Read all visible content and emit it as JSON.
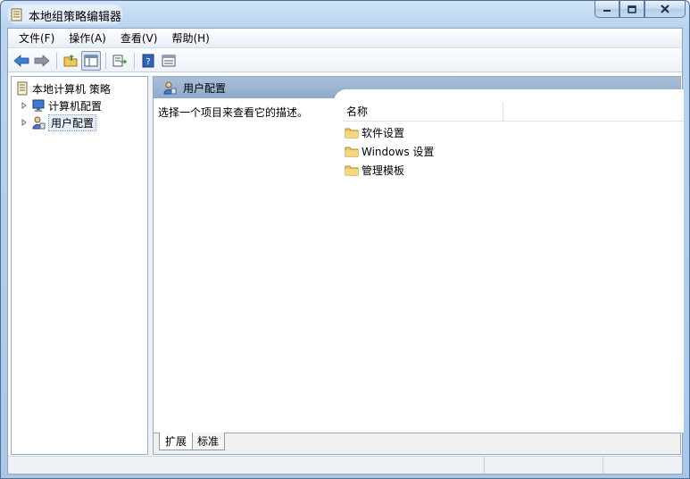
{
  "window": {
    "title": "本地组策略编辑器"
  },
  "menu": {
    "items": [
      {
        "label": "文件(F)"
      },
      {
        "label": "操作(A)"
      },
      {
        "label": "查看(V)"
      },
      {
        "label": "帮助(H)"
      }
    ]
  },
  "toolbar": {
    "icons": [
      "back-arrow-icon",
      "forward-arrow-icon",
      "up-folder-icon",
      "show-hide-tree-icon",
      "export-list-icon",
      "help-icon",
      "properties-icon"
    ]
  },
  "tree": {
    "root": "本地计算机 策略",
    "children": [
      {
        "label": "计算机配置"
      },
      {
        "label": "用户配置"
      }
    ]
  },
  "detail": {
    "header": "用户配置",
    "description": "选择一个项目来查看它的描述。",
    "column_name": "名称",
    "items": [
      {
        "label": "软件设置"
      },
      {
        "label": "Windows 设置"
      },
      {
        "label": "管理模板"
      }
    ]
  },
  "tabs": {
    "extended": "扩展",
    "standard": "标准"
  },
  "colors": {
    "header_band": "#8eabcc",
    "window_frame": "#b9d4ee",
    "folder": "#f1c75a"
  }
}
